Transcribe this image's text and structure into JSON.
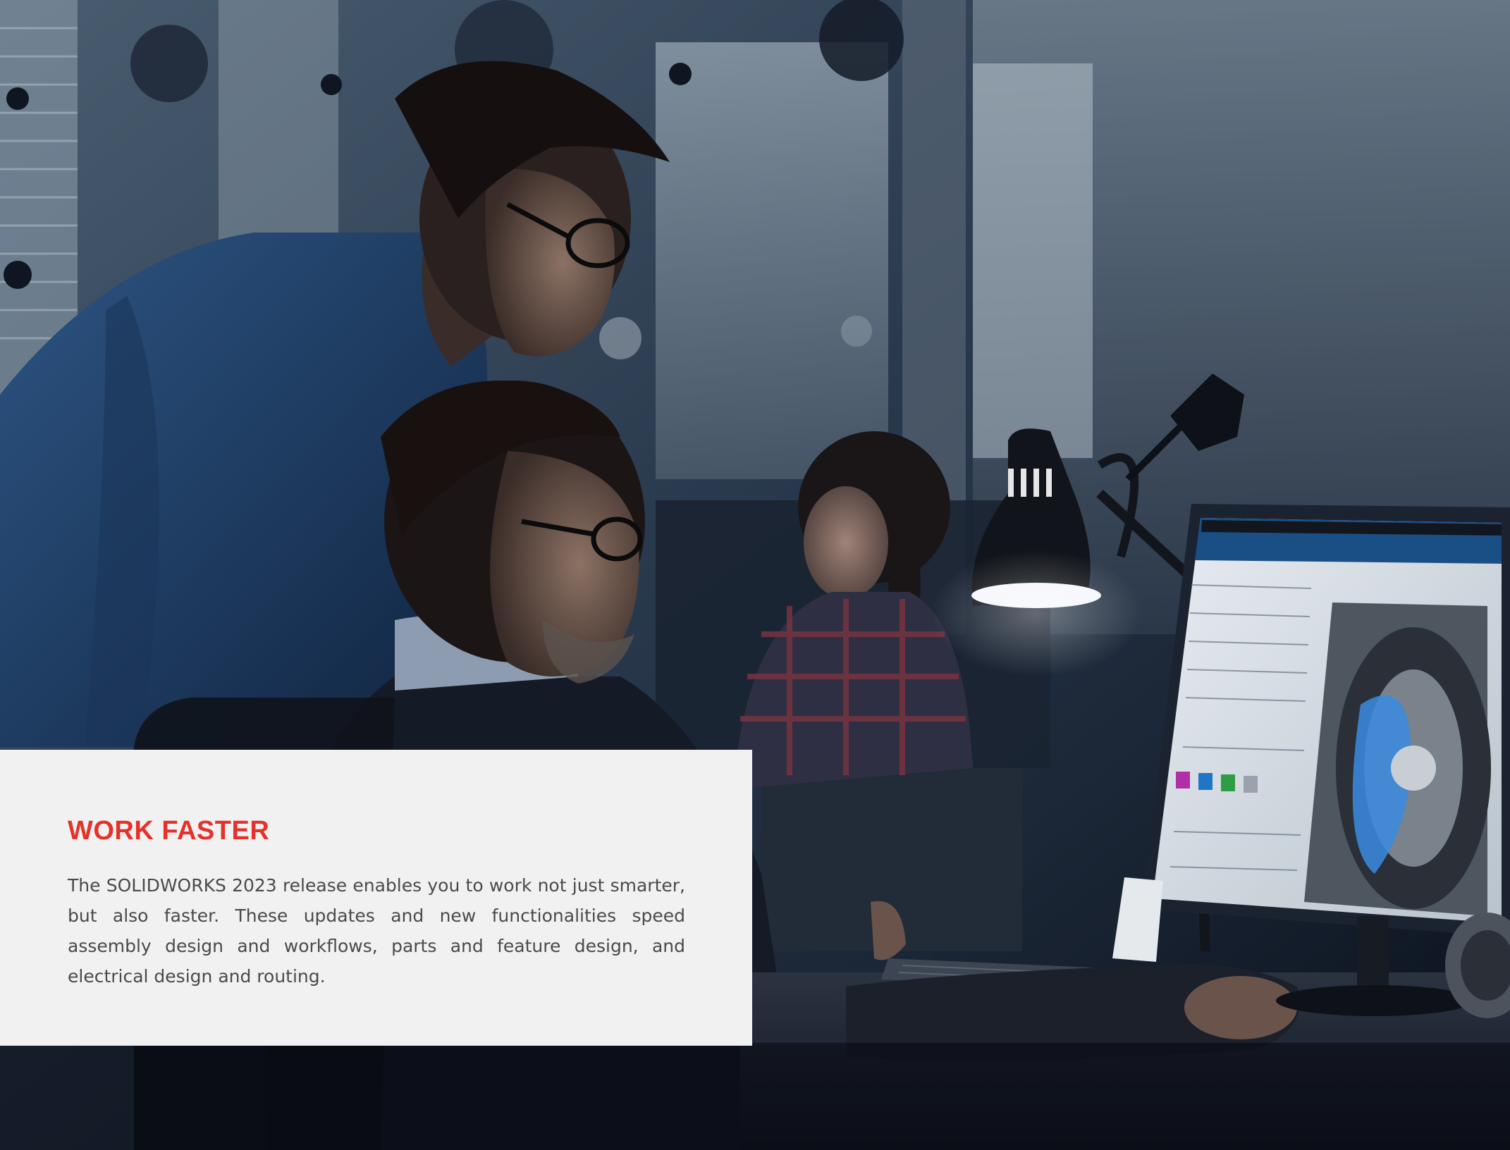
{
  "panel": {
    "title": "WORK FASTER",
    "body": "The SOLIDWORKS 2023 release enables you to work not just smarter, but also faster. These updates and new functionalities speed assembly design and workflows, parts and feature design, and electrical design and routing."
  },
  "colors": {
    "title_accent": "#e4322b",
    "panel_background": "#f1f1f1",
    "body_text": "#4a4a4a"
  }
}
